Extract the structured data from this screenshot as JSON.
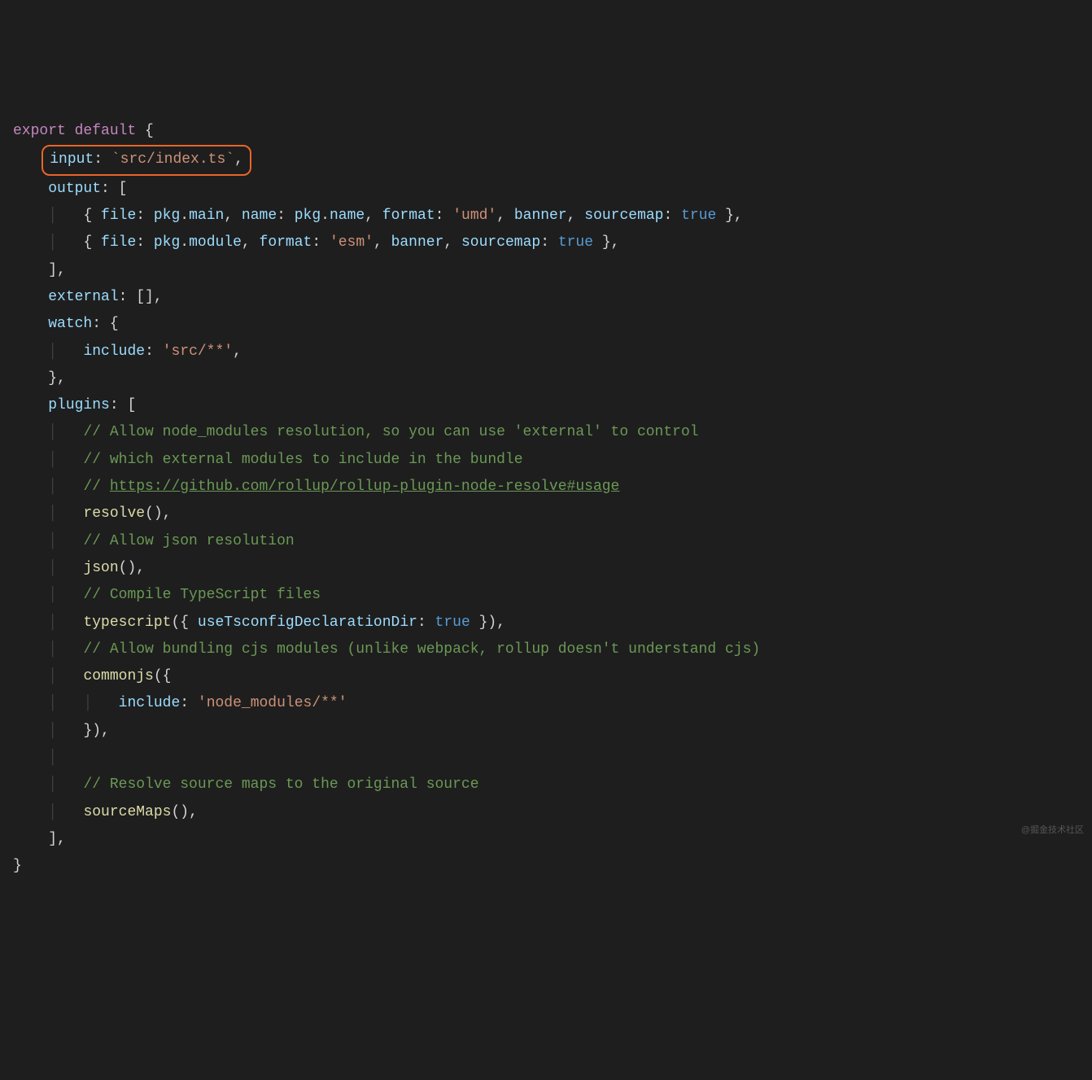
{
  "code": {
    "line1": {
      "export": "export",
      "default": "default",
      "brace": " {"
    },
    "line2": {
      "label": "input",
      "value": "`src/index.ts`"
    },
    "line3": {
      "label": "output",
      "open": ": ["
    },
    "line4": {
      "file_k": "file",
      "pkg1": "pkg",
      "main": "main",
      "name_k": "name",
      "pkg2": "pkg",
      "name_p": "name",
      "format_k": "format",
      "format_v": "'umd'",
      "banner": "banner",
      "srcmap_k": "sourcemap",
      "true_v": "true"
    },
    "line5": {
      "file_k": "file",
      "pkg1": "pkg",
      "module": "module",
      "format_k": "format",
      "format_v": "'esm'",
      "banner": "banner",
      "srcmap_k": "sourcemap",
      "true_v": "true"
    },
    "line6": {
      "close": "],"
    },
    "line7": {
      "label": "external",
      "value": "[],"
    },
    "line8": {
      "label": "watch",
      "open": "{"
    },
    "line9": {
      "label": "include",
      "value": "'src/**'"
    },
    "line10": {
      "close": "},"
    },
    "line11": {
      "label": "plugins",
      "open": "["
    },
    "line12": {
      "comment": "// Allow node_modules resolution, so you can use 'external' to control"
    },
    "line13": {
      "comment": "// which external modules to include in the bundle"
    },
    "line14": {
      "prefix": "// ",
      "link": "https://github.com/rollup/rollup-plugin-node-resolve#usage"
    },
    "line15": {
      "func": "resolve"
    },
    "line16": {
      "comment": "// Allow json resolution"
    },
    "line17": {
      "func": "json"
    },
    "line18": {
      "comment": "// Compile TypeScript files"
    },
    "line19": {
      "func": "typescript",
      "arg_k": "useTsconfigDeclarationDir",
      "arg_v": "true"
    },
    "line20": {
      "comment": "// Allow bundling cjs modules (unlike webpack, rollup doesn't understand cjs)"
    },
    "line21": {
      "func": "commonjs"
    },
    "line22": {
      "label": "include",
      "value": "'node_modules/**'"
    },
    "line23": {
      "close": "}),"
    },
    "line25": {
      "comment": "// Resolve source maps to the original source"
    },
    "line26": {
      "func": "sourceMaps"
    },
    "line27": {
      "close": "],"
    },
    "line28": {
      "close": "}"
    }
  },
  "watermark": "@掘金技术社区"
}
